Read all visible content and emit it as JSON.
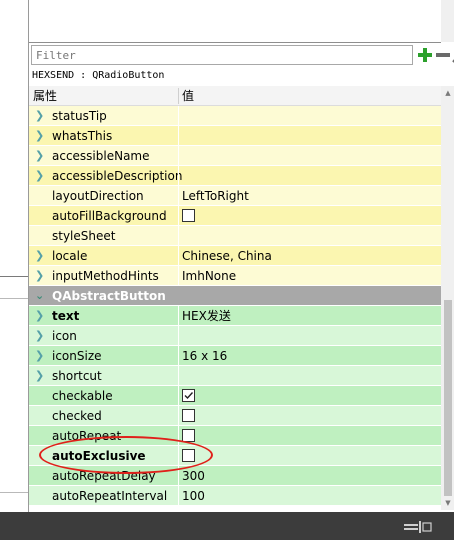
{
  "filter": {
    "placeholder": "Filter"
  },
  "toolbar": {
    "add_icon": "plus-icon",
    "remove_icon": "minus-icon",
    "config_icon": "wrench-icon"
  },
  "object": {
    "label": "HEXSEND : QRadioButton"
  },
  "header": {
    "property": "属性",
    "value": "值"
  },
  "colors": {
    "yellow_light": "#fdfbd4",
    "yellow_dark": "#fbf6b0",
    "green_light": "#d8f7d8",
    "green_dark": "#bff0c0",
    "section": "#a8a8a8",
    "annotation": "#e0201a",
    "statusbar": "#3c3c3c"
  },
  "rows": [
    {
      "name": "statusTip",
      "value": "",
      "expandable": true
    },
    {
      "name": "whatsThis",
      "value": "",
      "expandable": true
    },
    {
      "name": "accessibleName",
      "value": "",
      "expandable": true
    },
    {
      "name": "accessibleDescription",
      "value": "",
      "expandable": true
    },
    {
      "name": "layoutDirection",
      "value": "LeftToRight"
    },
    {
      "name": "autoFillBackground",
      "checkbox": false
    },
    {
      "name": "styleSheet",
      "value": ""
    },
    {
      "name": "locale",
      "value": "Chinese, China",
      "expandable": true
    },
    {
      "name": "inputMethodHints",
      "value": "ImhNone",
      "expandable": true
    }
  ],
  "section": {
    "name": "QAbstractButton"
  },
  "button_rows": [
    {
      "name": "text",
      "value": "HEX发送",
      "expandable": true,
      "bold": true
    },
    {
      "name": "icon",
      "value": "",
      "expandable": true
    },
    {
      "name": "iconSize",
      "value": "16 x 16",
      "expandable": true
    },
    {
      "name": "shortcut",
      "value": "",
      "expandable": true
    },
    {
      "name": "checkable",
      "checkbox": true
    },
    {
      "name": "checked",
      "checkbox": false
    },
    {
      "name": "autoRepeat",
      "checkbox": false
    },
    {
      "name": "autoExclusive",
      "checkbox": false,
      "bold": true
    },
    {
      "name": "autoRepeatDelay",
      "value": "300"
    },
    {
      "name": "autoRepeatInterval",
      "value": "100"
    }
  ]
}
